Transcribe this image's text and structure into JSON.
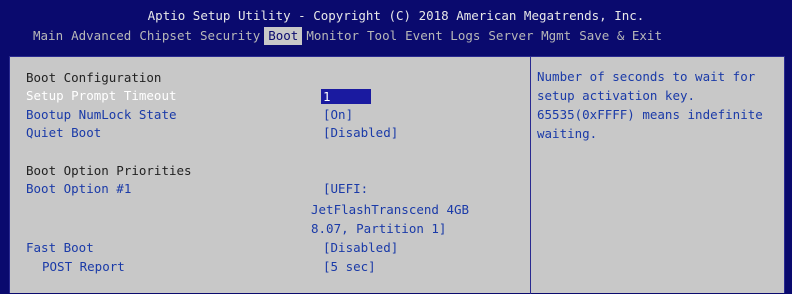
{
  "header": {
    "title": "Aptio Setup Utility - Copyright (C) 2018 American Megatrends, Inc.",
    "menu": [
      {
        "label": "Main",
        "active": false
      },
      {
        "label": "Advanced",
        "active": false
      },
      {
        "label": "Chipset",
        "active": false
      },
      {
        "label": "Security",
        "active": false
      },
      {
        "label": "Boot",
        "active": true
      },
      {
        "label": "Monitor",
        "active": false
      },
      {
        "label": "Tool",
        "active": false
      },
      {
        "label": "Event Logs",
        "active": false
      },
      {
        "label": "Server Mgmt",
        "active": false
      },
      {
        "label": "Save & Exit",
        "active": false
      }
    ]
  },
  "settings": {
    "boot_config_heading": "Boot Configuration",
    "setup_prompt_timeout": {
      "label": "Setup Prompt Timeout",
      "value": "1"
    },
    "numlock": {
      "label": "Bootup NumLock State",
      "value": "[On]"
    },
    "quiet_boot": {
      "label": "Quiet Boot",
      "value": "[Disabled]"
    },
    "priorities_heading": "Boot Option Priorities",
    "boot_option_1": {
      "label": "Boot Option #1",
      "value_lines": [
        "[UEFI:",
        "JetFlashTranscend 4GB",
        "8.07, Partition 1]"
      ]
    },
    "fast_boot": {
      "label": "Fast Boot",
      "value": "[Disabled]"
    },
    "post_report": {
      "label": "POST Report",
      "value": "[5 sec]"
    }
  },
  "help": {
    "lines": [
      "Number of seconds to wait for",
      "setup activation key.",
      "65535(0xFFFF) means indefinite",
      "waiting."
    ]
  }
}
